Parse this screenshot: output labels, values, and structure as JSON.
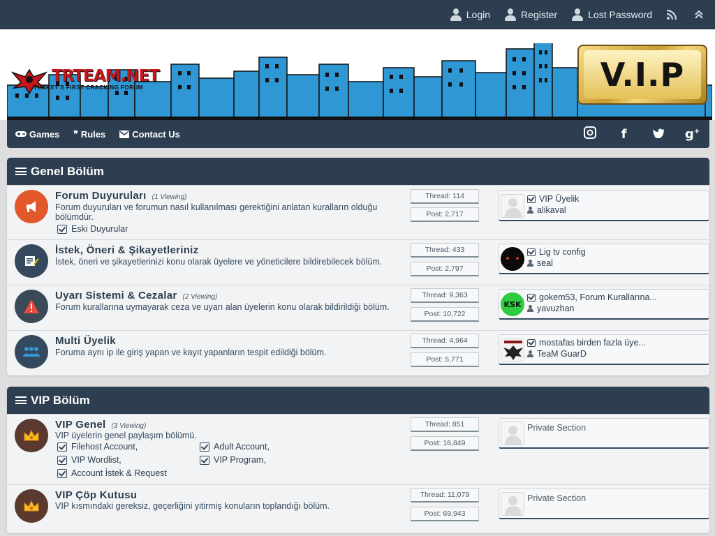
{
  "topbar": {
    "links": [
      {
        "label": "Login",
        "icon": "user-icon"
      },
      {
        "label": "Register",
        "icon": "user-icon"
      },
      {
        "label": "Lost Password",
        "icon": "user-icon"
      }
    ]
  },
  "header": {
    "logo_text": "TRTEAM.NET",
    "logo_sub": "TURKEY'S FIRST CRACKING FORUM",
    "vip_badge": "V.I.P"
  },
  "nav": {
    "items": [
      {
        "label": "Games",
        "icon": "gamepad-icon"
      },
      {
        "label": "Rules",
        "icon": "quote-icon"
      },
      {
        "label": "Contact Us",
        "icon": "envelope-icon"
      }
    ],
    "social": [
      "instagram-icon",
      "facebook-icon",
      "twitter-icon",
      "google-plus-icon"
    ]
  },
  "categories": [
    {
      "title": "Genel Bölüm",
      "forums": [
        {
          "title": "Forum Duyuruları",
          "viewing": "(1 Viewing)",
          "description": "Forum duyuruları ve forumun nasıl kullanılması gerektiğini anlatan kuralların olduğu bölümdür.",
          "subforums": [
            "Eski Duyurular"
          ],
          "threads": "Thread: 114",
          "posts": "Post: 2,717",
          "last_title": "VIP Üyelik",
          "last_user": "alikaval",
          "icon_color": "#e2582b"
        },
        {
          "title": "İstek, Öneri & Şikayetleriniz",
          "viewing": "",
          "description": "İstek, öneri ve şikayetlerinizi konu olarak üyelere ve yöneticilere bildirebilecek bölüm.",
          "subforums": [],
          "threads": "Thread: 433",
          "posts": "Post: 2,797",
          "last_title": "Lig tv config",
          "last_user": "seal",
          "icon_color": "#34495e"
        },
        {
          "title": "Uyarı Sistemi & Cezalar",
          "viewing": "(2 Viewing)",
          "description": "Forum kurallarına uymayarak ceza ve uyarı alan üyelerin konu olarak bildirildiği bölüm.",
          "subforums": [],
          "threads": "Thread: 9,363",
          "posts": "Post: 10,722",
          "last_title": "gokem53, Forum Kurallarına...",
          "last_user": "yavuzhan",
          "icon_color": "#3b4a57"
        },
        {
          "title": "Multi Üyelik",
          "viewing": "",
          "description": "Foruma aynı ip ile giriş yapan ve kayıt yapanların tespit edildiği bölüm.",
          "subforums": [],
          "threads": "Thread: 4,964",
          "posts": "Post: 5,771",
          "last_title": "mostafas birden fazla üye...",
          "last_user": "TeaM GuarD",
          "icon_color": "#34495e"
        }
      ]
    },
    {
      "title": "VIP Bölüm",
      "forums": [
        {
          "title": "VIP Genel",
          "viewing": "(3 Viewing)",
          "description": "VIP üyelerin genel paylaşım bölümü.",
          "subforums": [
            "Filehost Account,",
            "Adult Account,",
            "VIP Wordlist,",
            "VIP Program,",
            "Account İstek & Request"
          ],
          "threads": "Thread: 851",
          "posts": "Post: 16,849",
          "last_title": "Private Section",
          "last_user": "",
          "icon_color": "#5a3a2e"
        },
        {
          "title": "VIP Çöp Kutusu",
          "viewing": "",
          "description": "VIP kısmındaki gereksiz, geçerliğini yitirmiş konuların toplandığı bölüm.",
          "subforums": [],
          "threads": "Thread: 11,079",
          "posts": "Post: 69,943",
          "last_title": "Private Section",
          "last_user": "",
          "icon_color": "#5a3a2e"
        }
      ]
    }
  ]
}
